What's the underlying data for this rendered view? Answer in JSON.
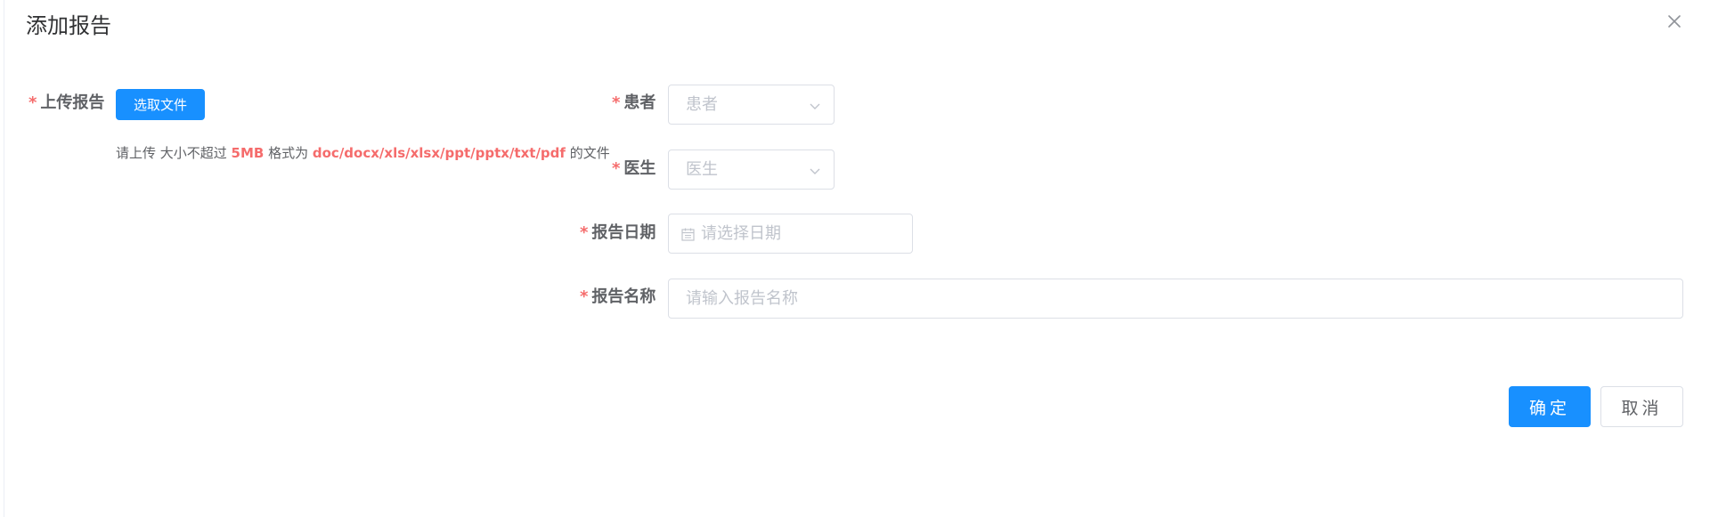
{
  "dialog": {
    "title": "添加报告",
    "close_icon": "close-icon"
  },
  "upload": {
    "required_mark": "*",
    "label": "上传报告",
    "button_label": "选取文件",
    "tip_prefix": "请上传 大小不超过 ",
    "tip_size": "5MB",
    "tip_middle": " 格式为 ",
    "tip_formats": "doc/docx/xls/xlsx/ppt/pptx/txt/pdf",
    "tip_suffix": " 的文件"
  },
  "patient": {
    "required_mark": "*",
    "label": "患者",
    "placeholder": "患者",
    "icon": "chevron-down-icon"
  },
  "doctor": {
    "required_mark": "*",
    "label": "医生",
    "placeholder": "医生",
    "icon": "chevron-down-icon"
  },
  "report_date": {
    "required_mark": "*",
    "label": "报告日期",
    "placeholder": "请选择日期",
    "icon": "calendar-icon"
  },
  "report_name": {
    "required_mark": "*",
    "label": "报告名称",
    "placeholder": "请输入报告名称",
    "value": ""
  },
  "footer": {
    "confirm_label": "确定",
    "cancel_label": "取消"
  },
  "colors": {
    "primary": "#1890ff",
    "required": "#f56c6c",
    "placeholder": "#c0c4cc",
    "border": "#dcdfe6",
    "label": "#606266"
  }
}
